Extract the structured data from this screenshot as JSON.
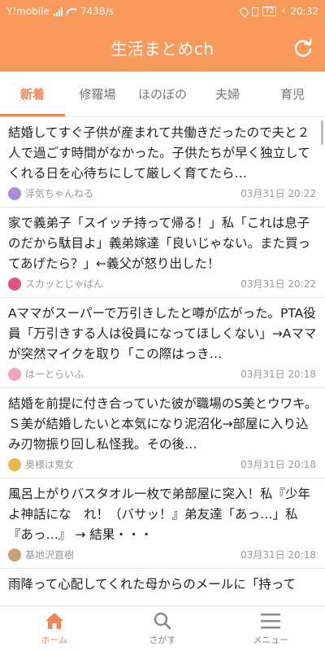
{
  "statusbar": {
    "carrier": "Y!mobile",
    "speed": "743B/s",
    "battery": "72",
    "time": "20:32"
  },
  "appbar": {
    "title": "生活まとめch"
  },
  "tabs": [
    {
      "label": "新着",
      "active": true
    },
    {
      "label": "修羅場"
    },
    {
      "label": "ほのぼの"
    },
    {
      "label": "夫婦"
    },
    {
      "label": "育児"
    }
  ],
  "items": [
    {
      "title": "結婚してすぐ子供が産まれて共働きだったので夫と２人で過ごす時間がなかった。子供たちが早く独立してくれる日を心待ちにして厳しく育てたら…",
      "source": "浮気ちゃんねる",
      "time": "03月31日 20:22",
      "avatar_color": "#a98fd6"
    },
    {
      "title": "家で義弟子「スイッチ持って帰る！」私「これは息子のだから駄目よ」義弟嫁達「良いじゃない。また買ってあげたら？」←義父が怒り出した！",
      "source": "スカッとじゃぱん",
      "time": "03月31日 20:22",
      "avatar_color": "#e0527f"
    },
    {
      "title": "Aママがスーパーで万引きしたと噂が広がった。PTA役員「万引きする人は役員になってほしくない」→Aママが突然マイクを取り「この際はっき…",
      "source": "はーとらいふ",
      "time": "03月31日 20:18",
      "avatar_color": "#f2a7b8"
    },
    {
      "title": "結婚を前提に付き合っていた彼が職場のS美とウワキ。Ｓ美が結婚したいと本気になり泥沼化→部屋に入り込み刃物振り回し私怪我。その後…",
      "source": "奥様は鬼女",
      "time": "03月31日 20:18",
      "avatar_color": "#e8b84a"
    },
    {
      "title": "風呂上がりバスタオル一枚で弟部屋に突入！私『少年よ神話にな　れ！（バサッ！』弟友達「あっ…」私『あっ…』 → 結果・・・",
      "source": "基地沢直樹",
      "time": "03月31日 20:18",
      "avatar_color": "#c9a27a"
    },
    {
      "title": "雨降って心配してくれた母からのメールに「持って",
      "source": "",
      "time": "",
      "avatar_color": "#cccccc"
    }
  ],
  "bottomnav": [
    {
      "label": "ホーム",
      "icon": "home-icon",
      "active": true
    },
    {
      "label": "さがす",
      "icon": "search-icon"
    },
    {
      "label": "メニュー",
      "icon": "menu-icon"
    }
  ],
  "colors": {
    "accent": "#f79a5c",
    "tab_active": "#f2865b"
  }
}
